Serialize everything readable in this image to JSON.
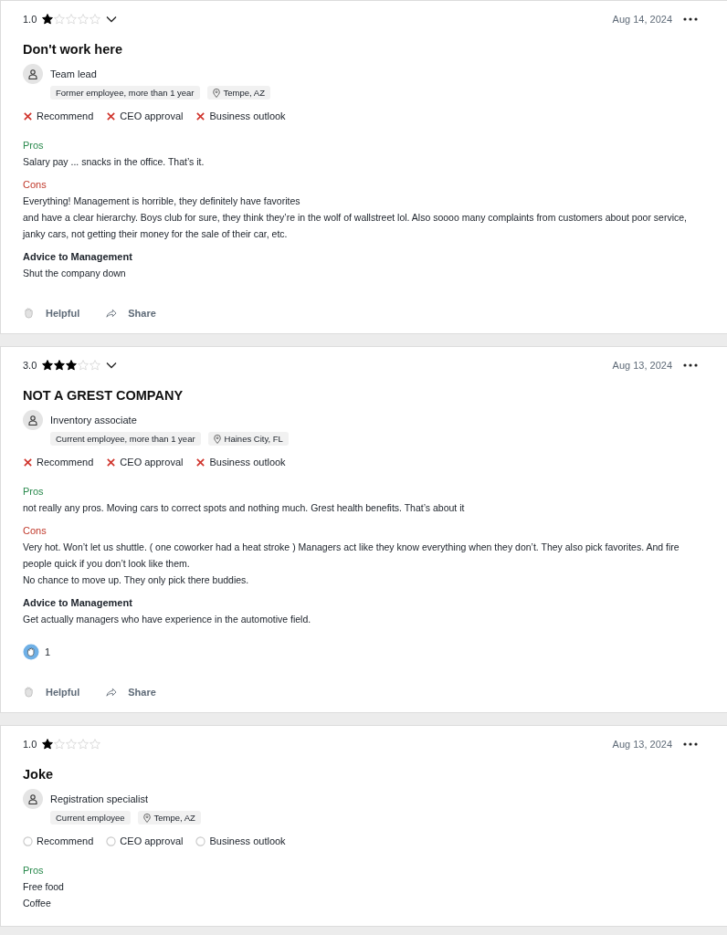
{
  "reviews": [
    {
      "rating": "1.0",
      "stars": 1,
      "expandable": true,
      "date": "Aug 14, 2024",
      "title": "Don't work here",
      "job_title": "Team lead",
      "tags": [
        {
          "kind": "status",
          "text": "Former employee, more than 1 year"
        },
        {
          "kind": "location",
          "text": "Tempe, AZ"
        }
      ],
      "sentiments": [
        {
          "kind": "negative",
          "label": "Recommend"
        },
        {
          "kind": "negative",
          "label": "CEO approval"
        },
        {
          "kind": "negative",
          "label": "Business outlook"
        }
      ],
      "sections": [
        {
          "kind": "pros",
          "heading": "Pros",
          "lines": [
            "Salary pay ... snacks in the office. That’s it."
          ]
        },
        {
          "kind": "cons",
          "heading": "Cons",
          "lines": [
            "Everything! Management is horrible, they definitely have favorites",
            "and have a clear hierarchy. Boys club for sure, they think they’re in the wolf of wallstreet lol. Also soooo many complaints from customers about poor service, janky cars, not getting their money for the sale of their car, etc."
          ]
        },
        {
          "kind": "advice",
          "heading": "Advice to Management",
          "lines": [
            "Shut the company down"
          ]
        }
      ],
      "actions": [
        {
          "kind": "helpful",
          "label": "Helpful"
        },
        {
          "kind": "share",
          "label": "Share"
        }
      ]
    },
    {
      "rating": "3.0",
      "stars": 3,
      "expandable": true,
      "date": "Aug 13, 2024",
      "title": "NOT A GREST COMPANY",
      "job_title": "Inventory associate",
      "tags": [
        {
          "kind": "status",
          "text": "Current employee, more than 1 year"
        },
        {
          "kind": "location",
          "text": "Haines City, FL"
        }
      ],
      "sentiments": [
        {
          "kind": "negative",
          "label": "Recommend"
        },
        {
          "kind": "negative",
          "label": "CEO approval"
        },
        {
          "kind": "negative",
          "label": "Business outlook"
        }
      ],
      "sections": [
        {
          "kind": "pros",
          "heading": "Pros",
          "lines": [
            "not really any pros. Moving cars to correct spots and nothing much. Grest health benefits. That’s about it"
          ]
        },
        {
          "kind": "cons",
          "heading": "Cons",
          "lines": [
            "Very hot. Won’t let us shuttle. ( one coworker had a heat stroke ) Managers act like they know everything when they don’t. They also pick favorites. And fire people quick if you don’t look like them.",
            "No chance to move up. They only pick there buddies."
          ]
        },
        {
          "kind": "advice",
          "heading": "Advice to Management",
          "lines": [
            "Get actually managers who have experience in the automotive field."
          ]
        }
      ],
      "helpful_count": "1",
      "actions": [
        {
          "kind": "helpful",
          "label": "Helpful"
        },
        {
          "kind": "share",
          "label": "Share"
        }
      ]
    },
    {
      "rating": "1.0",
      "stars": 1,
      "expandable": false,
      "date": "Aug 13, 2024",
      "title": "Joke",
      "job_title": "Registration specialist",
      "tags": [
        {
          "kind": "status",
          "text": "Current employee"
        },
        {
          "kind": "location",
          "text": "Tempe, AZ"
        }
      ],
      "sentiments": [
        {
          "kind": "neutral",
          "label": "Recommend"
        },
        {
          "kind": "neutral",
          "label": "CEO approval"
        },
        {
          "kind": "neutral",
          "label": "Business outlook"
        }
      ],
      "sections": [
        {
          "kind": "pros",
          "heading": "Pros",
          "lines": [
            "Free food",
            "Coffee"
          ]
        }
      ]
    }
  ]
}
